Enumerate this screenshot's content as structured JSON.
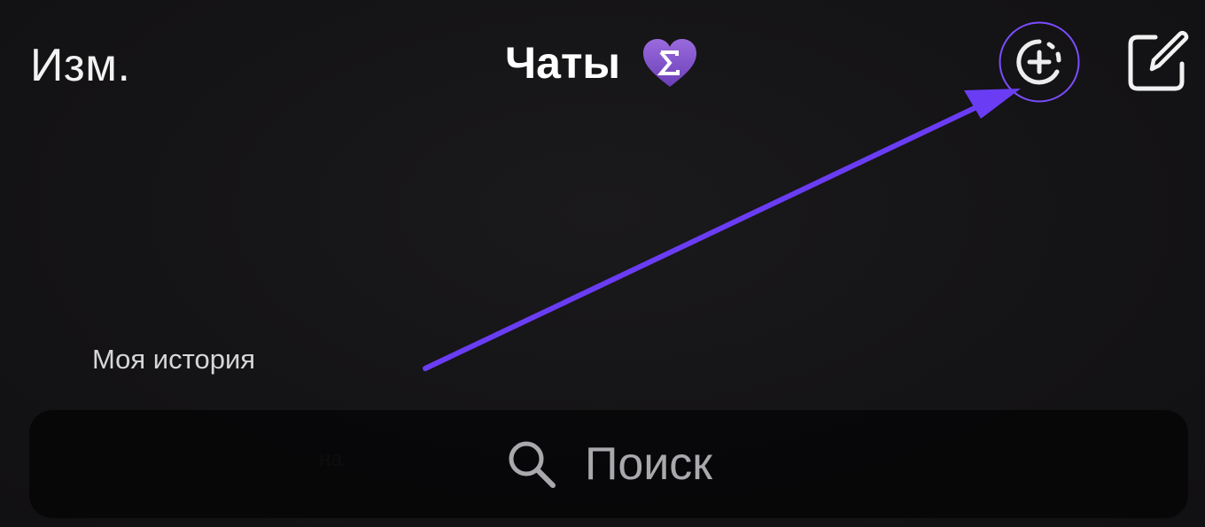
{
  "header": {
    "edit_label": "Изм.",
    "title": "Чаты",
    "badge_icon": "heart-sigma-icon",
    "story_add_icon": "story-add-icon",
    "compose_icon": "compose-icon"
  },
  "stories": {
    "my_story_label": "Моя история",
    "partial_text": "на"
  },
  "search": {
    "icon": "search-icon",
    "placeholder": "Поиск"
  },
  "annotation": {
    "arrow_color": "#6a3df5",
    "highlight_color": "#7b4dff"
  },
  "colors": {
    "background": "#141315",
    "accent_purple": "#8a5bd6",
    "text_primary": "#ffffff",
    "text_secondary": "#a9a9ad"
  }
}
